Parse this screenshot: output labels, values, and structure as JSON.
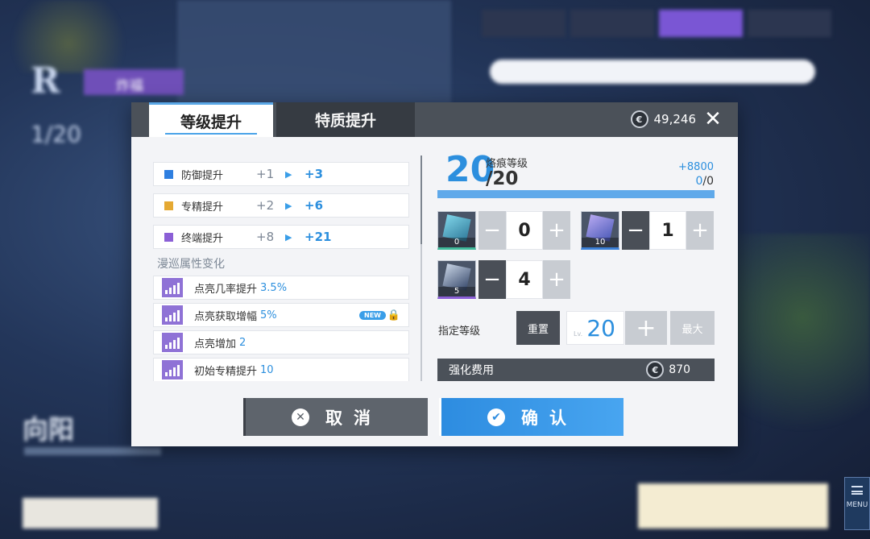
{
  "background": {
    "letter": "R",
    "tag": "炸福",
    "count": "1/20",
    "name": "向阳",
    "menu_label": "MENU"
  },
  "dialog": {
    "tabs": {
      "level": "等级提升",
      "trait": "特质提升"
    },
    "currency": "49,246",
    "stats": [
      {
        "name": "防御提升",
        "from": "+1",
        "to": "+3",
        "color": "#2f7fe0"
      },
      {
        "name": "专精提升",
        "from": "+2",
        "to": "+6",
        "color": "#e5a933"
      },
      {
        "name": "终端提升",
        "from": "+8",
        "to": "+21",
        "color": "#8b5fd6"
      }
    ],
    "roam_title": "漫巡属性变化",
    "roam": [
      {
        "name": "点亮几率提升",
        "value": "3.5%"
      },
      {
        "name": "点亮获取增幅",
        "value": "5%",
        "badge": "NEW"
      },
      {
        "name": "点亮增加",
        "value": "2"
      },
      {
        "name": "初始专精提升",
        "value": "10"
      }
    ],
    "level": {
      "current": "20",
      "label": "烙痕等级",
      "max": "/20",
      "exp_gain": "+8800",
      "exp_current": "0",
      "exp_total": "/0",
      "exp_fill": 1.0
    },
    "materials": [
      {
        "count": "0",
        "qty": "0"
      },
      {
        "count": "10",
        "qty": "1"
      },
      {
        "count": "5",
        "qty": "4"
      }
    ],
    "set_level": {
      "label": "指定等级",
      "reset": "重置",
      "lv_tag": "Lv.",
      "value": "20",
      "max": "最大"
    },
    "cost": {
      "label": "强化费用",
      "value": "870"
    },
    "buttons": {
      "cancel": "取消",
      "confirm": "确认"
    }
  }
}
